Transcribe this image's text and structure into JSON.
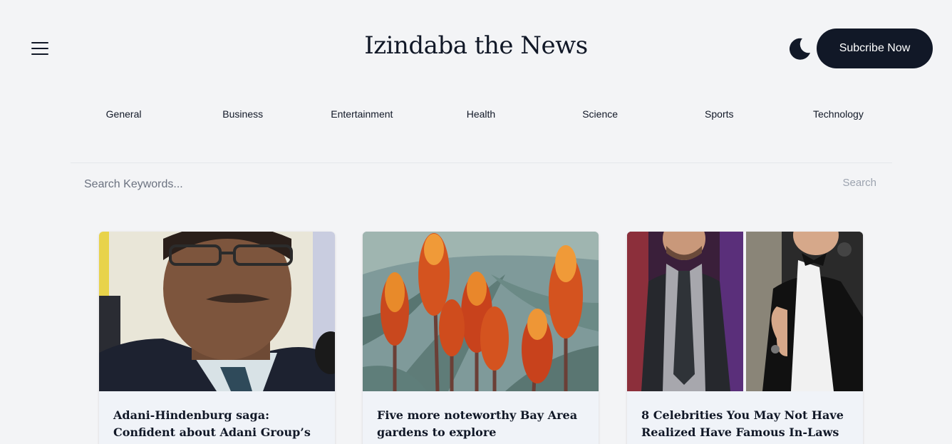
{
  "header": {
    "title": "Izindaba the News",
    "subscribe_label": "Subcribe Now",
    "menu_icon": "hamburger-menu-icon",
    "theme_icon": "moon-icon"
  },
  "categories": [
    "General",
    "Business",
    "Entertainment",
    "Health",
    "Science",
    "Sports",
    "Technology"
  ],
  "search": {
    "placeholder": "Search Keywords...",
    "button_label": "Search"
  },
  "articles": [
    {
      "title": "Adani-Hindenburg saga: Confident about Adani Group’s business",
      "image": "man-in-glasses-photo"
    },
    {
      "title": "Five more noteworthy Bay Area gardens to explore",
      "image": "orange-aloe-flowers-photo"
    },
    {
      "title": "8 Celebrities You May Not Have Realized Have Famous In-Laws",
      "image": "two-men-in-suits-photo"
    }
  ],
  "colors": {
    "primary": "#111827",
    "background": "#f3f4f6",
    "card": "#f0f3f8"
  }
}
